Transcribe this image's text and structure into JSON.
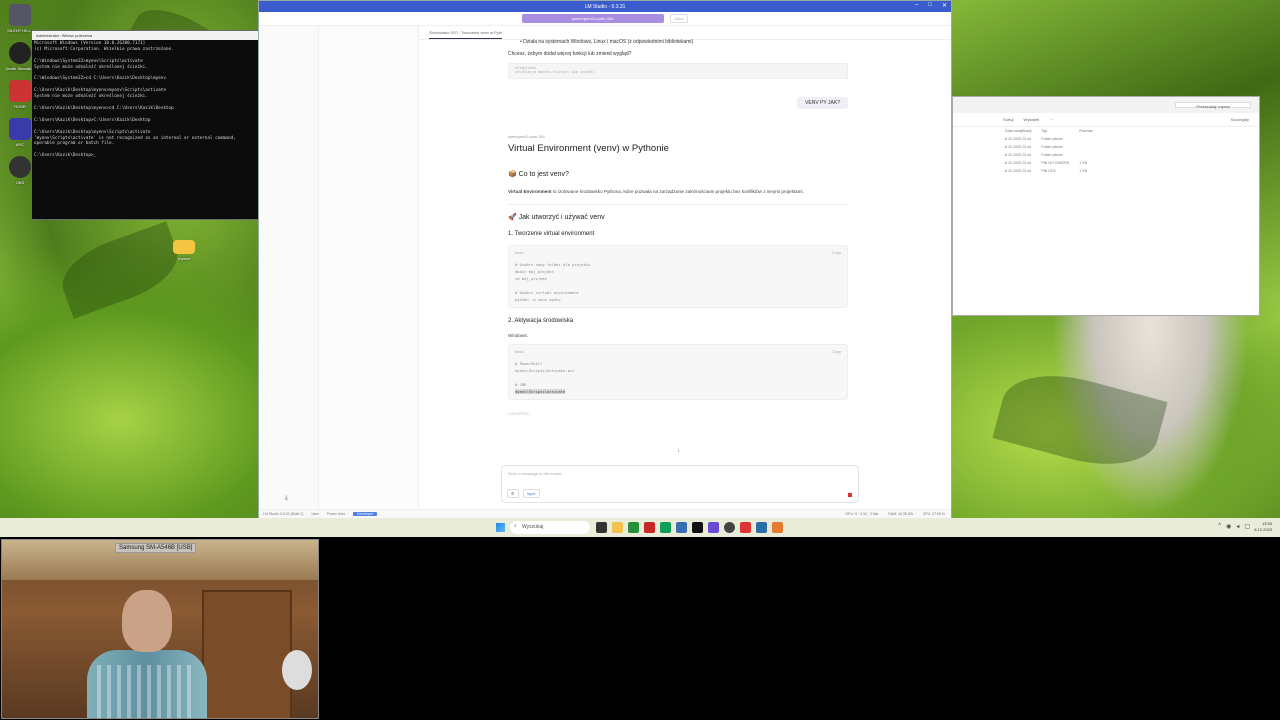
{
  "desktop": {
    "icons": [
      {
        "label": "SILENT HILL f"
      },
      {
        "label": "Death Stranding"
      },
      {
        "label": "ROBR"
      },
      {
        "label": "ARC"
      },
      {
        "label": "OBS"
      },
      {
        "label": "myenv"
      }
    ]
  },
  "cmd": {
    "title": "Administrator: Wiersz polecenia",
    "lines": "Microsoft Windows [Version 10.0.26200.7171]\n(c) Microsoft Corporation. Wszelkie prawa zastrzeżone.\n\nC:\\Windows\\System32>myenv\\Scripts\\activate\nSystem nie może odnaleźć określonej ścieżki.\n\nC:\\Windows\\System32>cd C:\\Users\\Kazik\\Desktop\\myenv\n\nC:\\Users\\Kazik\\Desktop\\myenv>myenv\\Scripts\\activate\nSystem nie może odnaleźć określonej ścieżki.\n\nC:\\Users\\Kazik\\Desktop\\myenv>cd C:\\Users\\Kazik\\Desktop\n\nC:\\Users\\Kazik\\Desktop>C:\\Users\\Kazik\\Desktop\n\nC:\\Users\\Kazik\\Desktop\\myenv\\Scripts\\activate\n'myenv\\Scripts\\activate' is not recognized as an internal or external command,\noperable program or batch file.\n\nC:\\Users\\Kazik\\Desktop>_"
  },
  "lmstudio": {
    "title": "LM Studio - 0.3.31",
    "model": "qwen/qwen3-coder-30b",
    "eject": "Eject",
    "tab": "Środowisko ISO · Tworzenie venv w Pyth",
    "chat": {
      "bullet": "Działa na systemach Windows, Linux i macOS (z odpowiednimi bibliotekami)",
      "question": "Chcesz, żebym dodał więcej funkcji lub zmienił wygląd?",
      "mini_code_title": "sklep/venv",
      "mini_code_line": "instalacja modułu tkinter: pip install",
      "user_msg": "VENV PY JAK?",
      "model_tag": "qwen/qwen3-coder-30b",
      "h1": "Virtual Environment (venv) w Pythonie",
      "h2_what": "📦 Co to jest venv?",
      "what_bold": "Virtual Environment",
      "what_text": " to izolowane środowisko Pythona, które pozwala na zarządzanie zależnościami projektu bez konfliktów z innymi projektami.",
      "h2_how": "🚀 Jak utworzyć i używać venv",
      "h3_create": "1. Tworzenie virtual environment",
      "code1_lang": "bash",
      "code1": "# Utwórz nowy folder dla projektu\nmkdir moj_projekt\ncd moj_projekt\n\n# Utwórz virtual environment\npython -m venv myenv",
      "h3_activate": "2. Aktywacja środowiska",
      "windows_label": "Windows:",
      "code2_lang": "bash",
      "code2_a": "# PowerShell\nmyenv\\Scripts\\Activate.ps1\n\n# CMD",
      "code2_hl": "myenv\\Scripts\\activate",
      "copy": "Copy",
      "linux_label": "Linux/Mac:"
    },
    "composer": {
      "placeholder": "Send a message to the model...",
      "tool1": "⚙",
      "tool2": "Input"
    },
    "status": {
      "app": "LM Studio 0.3.31 (Build 2)",
      "user": "User",
      "power": "Power User",
      "dev": "Developer",
      "s1": "GPU: 0 · 0.34 · 3 bits",
      "s2": "RAM: 16.35 GB",
      "s3": "CPU: 37.05 %"
    }
  },
  "explorer": {
    "search": "Przeszukaj: myenv",
    "toolbar": [
      "Sortuj",
      "Wyświetl",
      "···"
    ],
    "details": "Szczegóły",
    "columns": [
      "Data modyfikacji",
      "Typ",
      "Rozmiar"
    ],
    "rows": [
      [
        "6.12.2025 13:44",
        "Folder plików",
        ""
      ],
      [
        "6.12.2025 13:44",
        "Folder plików",
        ""
      ],
      [
        "6.12.2025 13:44",
        "Folder plików",
        ""
      ],
      [
        "6.12.2025 13:44",
        "Plik GIT IGNORE",
        "1 KB"
      ],
      [
        "6.12.2025 13:44",
        "Plik CFG",
        "1 KB"
      ]
    ]
  },
  "taskbar": {
    "search": "Wyszukaj",
    "time": "13:55",
    "date": "6.12.2025"
  },
  "webcam": {
    "label": "Samsung SM-A546B [USB]"
  }
}
